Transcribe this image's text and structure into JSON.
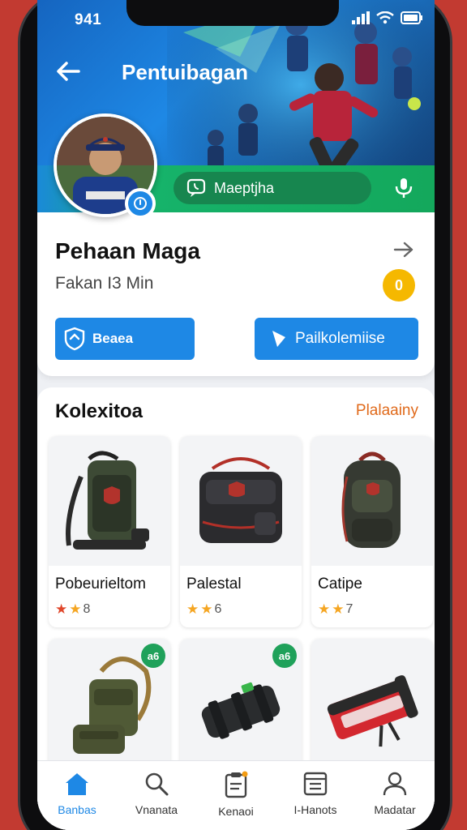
{
  "status_bar": {
    "time": "941"
  },
  "header": {
    "title": "Pentuibagan",
    "message_button": "Maeptjha"
  },
  "profile": {
    "name": "Pehaan Maga",
    "subtitle": "Fakan I3 Min",
    "coins": "0",
    "button_left": "Beaea",
    "button_right": "Pailkolemiise"
  },
  "collection": {
    "title": "Kolexitoa",
    "link": "Plalaainy",
    "items": [
      {
        "name": "Pobeurieltom",
        "rating": "8",
        "badge": ""
      },
      {
        "name": "Palestal",
        "rating": "6",
        "badge": ""
      },
      {
        "name": "Catipe",
        "rating": "7",
        "badge": ""
      },
      {
        "name": "",
        "rating": "",
        "badge": "a6"
      },
      {
        "name": "",
        "rating": "",
        "badge": "a6"
      },
      {
        "name": "",
        "rating": "",
        "badge": ""
      }
    ]
  },
  "nav": {
    "items": [
      {
        "label": "Banbas",
        "icon": "home-icon"
      },
      {
        "label": "Vnanata",
        "icon": "search-icon"
      },
      {
        "label": "Kenaoi",
        "icon": "clipboard-icon"
      },
      {
        "label": "I-Hanots",
        "icon": "window-icon"
      },
      {
        "label": "Madatar",
        "icon": "user-icon"
      }
    ]
  },
  "colors": {
    "primary": "#1e88e5",
    "accent_green": "#14a85c",
    "coin": "#f5b800",
    "link": "#e06a1b",
    "background": "#c23a31"
  }
}
